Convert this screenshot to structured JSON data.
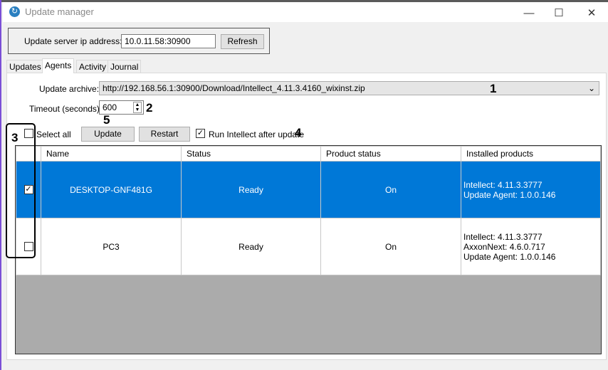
{
  "window": {
    "title": "Update manager",
    "minimize": "—",
    "maximize": "☐",
    "close": "✕"
  },
  "server": {
    "label": "Update server ip address:",
    "value": "10.0.11.58:30900",
    "refresh": "Refresh"
  },
  "tabs": [
    {
      "label": "Updates"
    },
    {
      "label": "Agents"
    },
    {
      "label": "Activity"
    },
    {
      "label": "Journal"
    }
  ],
  "agents": {
    "archive_label": "Update archive:",
    "archive_value": "http://192.168.56.1:30900/Download/Intellect_4.11.3.4160_wixinst.zip",
    "timeout_label": "Timeout (seconds):",
    "timeout_value": "600",
    "select_all": "Select all",
    "update": "Update",
    "restart": "Restart",
    "run_after": "Run Intellect after update",
    "run_after_checked": true,
    "columns": [
      "Name",
      "Status",
      "Product status",
      "Installed products"
    ],
    "rows": [
      {
        "checked": true,
        "name": "DESKTOP-GNF481G",
        "status": "Ready",
        "product_status": "On",
        "installed": [
          "Intellect: 4.11.3.3777",
          "Update Agent: 1.0.0.146"
        ]
      },
      {
        "checked": false,
        "name": "PC3",
        "status": "Ready",
        "product_status": "On",
        "installed": [
          "Intellect: 4.11.3.3777",
          "AxxonNext: 4.6.0.717",
          "Update Agent: 1.0.0.146"
        ]
      }
    ]
  },
  "callouts": {
    "archive": "1",
    "timeout": "2",
    "select": "3",
    "run_after": "4",
    "update": "5"
  },
  "colors": {
    "selection": "#0078d7",
    "grid_bg": "#ababab"
  }
}
